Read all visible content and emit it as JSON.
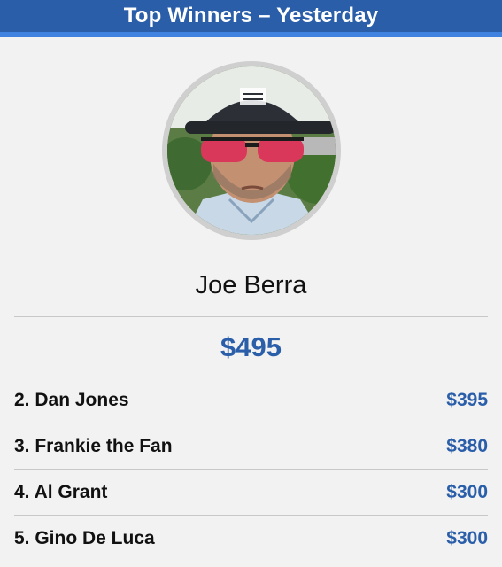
{
  "header": {
    "title": "Top Winners – Yesterday"
  },
  "winner": {
    "name": "Joe Berra",
    "amount": "$495",
    "avatar_icon": "winner-profile-photo"
  },
  "ranks": [
    {
      "label": "2. Dan Jones",
      "amount": "$395"
    },
    {
      "label": "3. Frankie the Fan",
      "amount": "$380"
    },
    {
      "label": "4. Al Grant",
      "amount": "$300"
    },
    {
      "label": "5. Gino De Luca",
      "amount": "$300"
    }
  ],
  "colors": {
    "header_bg": "#2a5ea9",
    "header_accent": "#3f82e0",
    "amount": "#2a5ea9",
    "page_bg": "#f2f2f2"
  }
}
